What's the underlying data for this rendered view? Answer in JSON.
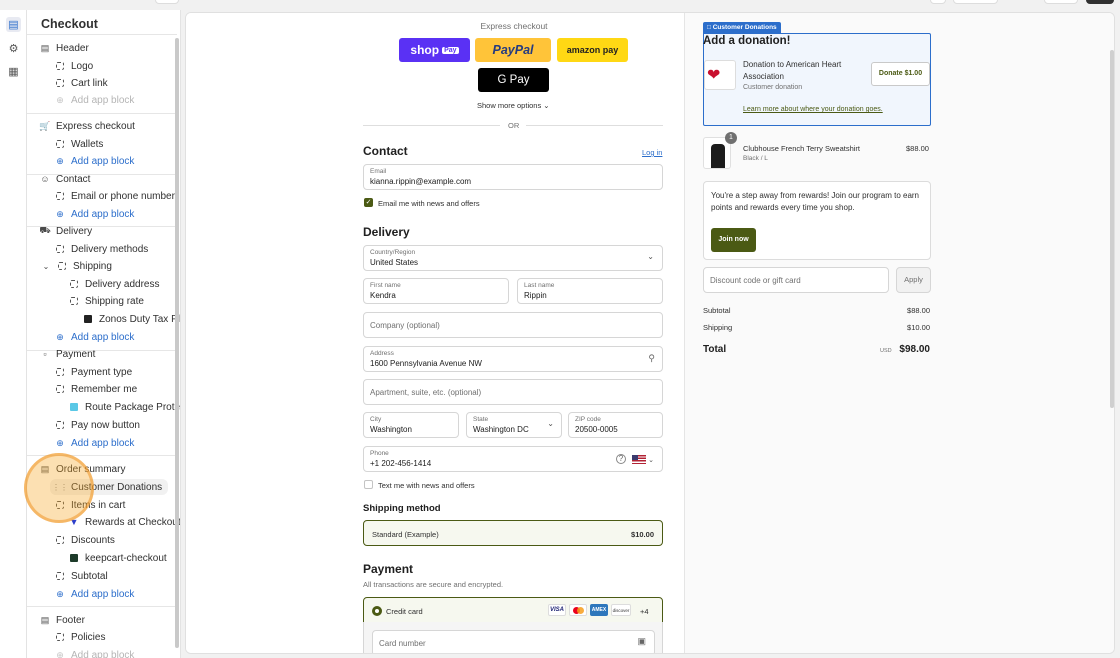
{
  "sidebar": {
    "title": "Checkout",
    "items": [
      {
        "label": "Header",
        "icon": "layout-header-icon"
      },
      {
        "label": "Logo",
        "icon": "block-icon"
      },
      {
        "label": "Cart link",
        "icon": "block-icon"
      },
      {
        "label": "Add app block",
        "icon": "plus-circle-icon"
      },
      {
        "label": "Express checkout",
        "icon": "cart-icon"
      },
      {
        "label": "Wallets",
        "icon": "block-icon"
      },
      {
        "label": "Add app block",
        "icon": "plus-circle-icon"
      },
      {
        "label": "Contact",
        "icon": "person-icon"
      },
      {
        "label": "Email or phone number",
        "icon": "block-icon"
      },
      {
        "label": "Add app block",
        "icon": "plus-circle-icon"
      },
      {
        "label": "Delivery",
        "icon": "truck-icon"
      },
      {
        "label": "Delivery methods",
        "icon": "block-icon"
      },
      {
        "label": "Shipping",
        "icon": "block-icon"
      },
      {
        "label": "Delivery address",
        "icon": "block-icon"
      },
      {
        "label": "Shipping rate",
        "icon": "block-icon"
      },
      {
        "label": "Zonos Duty Tax Plus...",
        "icon": "app-icon"
      },
      {
        "label": "Add app block",
        "icon": "plus-circle-icon"
      },
      {
        "label": "Payment",
        "icon": "cash-icon"
      },
      {
        "label": "Payment type",
        "icon": "block-icon"
      },
      {
        "label": "Remember me",
        "icon": "block-icon"
      },
      {
        "label": "Route Package Protection",
        "icon": "app-icon"
      },
      {
        "label": "Pay now button",
        "icon": "block-icon"
      },
      {
        "label": "Add app block",
        "icon": "plus-circle-icon"
      },
      {
        "label": "Order summary",
        "icon": "receipt-icon"
      },
      {
        "label": "Customer Donations",
        "icon": "drag-handle-icon"
      },
      {
        "label": "Items in cart",
        "icon": "block-icon"
      },
      {
        "label": "Rewards at Checkout",
        "icon": "app-icon"
      },
      {
        "label": "Discounts",
        "icon": "block-icon"
      },
      {
        "label": "keepcart-checkout",
        "icon": "app-icon"
      },
      {
        "label": "Subtotal",
        "icon": "block-icon"
      },
      {
        "label": "Add app block",
        "icon": "plus-circle-icon"
      },
      {
        "label": "Footer",
        "icon": "layout-footer-icon"
      },
      {
        "label": "Policies",
        "icon": "block-icon"
      },
      {
        "label": "Add app block",
        "icon": "plus-circle-icon"
      }
    ]
  },
  "express": {
    "label": "Express checkout",
    "shop": "shop",
    "shop_badge": "Pay",
    "paypal": "PayPal",
    "amazon": "amazon pay",
    "gpay": "G Pay",
    "show_more": "Show more options",
    "or": "OR"
  },
  "contact": {
    "heading": "Contact",
    "login": "Log in",
    "email_label": "Email",
    "email_value": "kianna.rippin@example.com",
    "news_label": "Email me with news and offers"
  },
  "delivery": {
    "heading": "Delivery",
    "country_label": "Country/Region",
    "country_value": "United States",
    "first_label": "First name",
    "first_value": "Kendra",
    "last_label": "Last name",
    "last_value": "Rippin",
    "company_placeholder": "Company (optional)",
    "address_label": "Address",
    "address_value": "1600 Pennsylvania Avenue NW",
    "apt_placeholder": "Apartment, suite, etc. (optional)",
    "city_label": "City",
    "city_value": "Washington",
    "state_label": "State",
    "state_value": "Washington DC",
    "zip_label": "ZIP code",
    "zip_value": "20500-0005",
    "phone_label": "Phone",
    "phone_value": "+1 202-456-1414",
    "text_label": "Text me with news and offers"
  },
  "shipping": {
    "heading": "Shipping method",
    "option": "Standard (Example)",
    "price": "$10.00"
  },
  "payment": {
    "heading": "Payment",
    "subtitle": "All transactions are secure and encrypted.",
    "method": "Credit card",
    "cards": [
      "VISA",
      "MC",
      "AMEX",
      "discover"
    ],
    "more": "+4",
    "card_number_placeholder": "Card number"
  },
  "donation": {
    "tag": "Customer Donations",
    "heading": "Add a donation!",
    "title": "Donation to American Heart Association",
    "subtitle": "Customer donation",
    "button": "Donate $1.00",
    "learn": "Learn more about where your donation goes."
  },
  "cart": {
    "qty": "1",
    "name": "Clubhouse French Terry Sweatshirt",
    "variant": "Black / L",
    "price": "$88.00"
  },
  "rewards": {
    "text": "You're a step away from rewards! Join our program to earn points and rewards every time you shop.",
    "button": "Join now"
  },
  "discount": {
    "placeholder": "Discount code or gift card",
    "apply": "Apply"
  },
  "totals": {
    "subtotal_label": "Subtotal",
    "subtotal_value": "$88.00",
    "shipping_label": "Shipping",
    "shipping_value": "$10.00",
    "total_label": "Total",
    "currency": "USD",
    "total_value": "$98.00"
  },
  "colors": {
    "accent_blue": "#2c6ecb",
    "olive": "#4b5a14",
    "shop_purple": "#5a31f4",
    "paypal_yellow": "#ffc439",
    "amazon_yellow": "#ffd814"
  }
}
